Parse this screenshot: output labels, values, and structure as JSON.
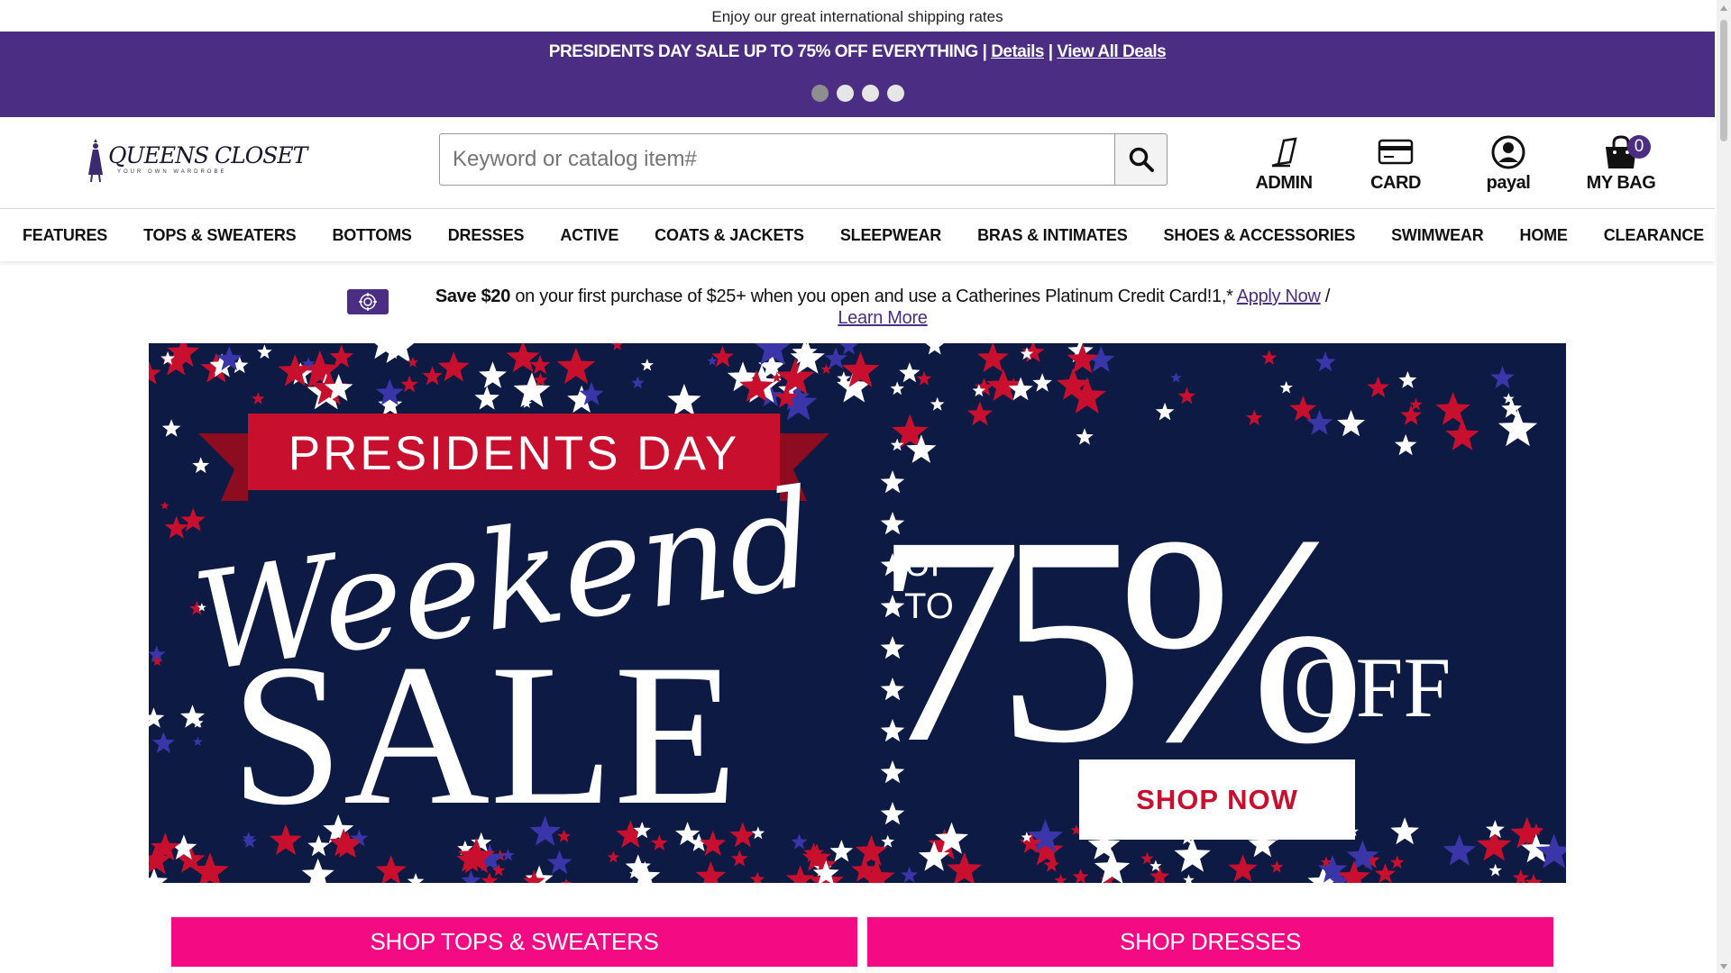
{
  "top_strip": {
    "text": "Enjoy our great international shipping rates"
  },
  "promo": {
    "headline": "PRESIDENTS DAY SALE UP TO 75% OFF EVERYTHING",
    "separator": "|",
    "details_link": "Details",
    "all_deals_link": "View All Deals",
    "slide_count": 4,
    "active_slide": 1
  },
  "header": {
    "logo_text": "QUEENS CLOSET",
    "logo_tagline": "YOUR OWN WARDROBE",
    "search": {
      "placeholder": "Keyword or catalog item#",
      "value": ""
    },
    "utilities": [
      {
        "label": "ADMIN",
        "icon": "pencil-icon"
      },
      {
        "label": "CARD",
        "icon": "credit-card-icon"
      },
      {
        "label": "payal",
        "icon": "user-icon"
      },
      {
        "label": "MY BAG",
        "icon": "shopping-bag-icon",
        "count": "0"
      }
    ]
  },
  "nav": {
    "items": [
      "FEATURES",
      "TOPS & SWEATERS",
      "BOTTOMS",
      "DRESSES",
      "ACTIVE",
      "COATS & JACKETS",
      "SLEEPWEAR",
      "BRAS & INTIMATES",
      "SHOES & ACCESSORIES",
      "SWIMWEAR",
      "HOME",
      "CLEARANCE"
    ]
  },
  "offer": {
    "bold": "Save $20",
    "text": " on your first purchase of $25+ when you open and use a Catherines Platinum Credit Card!1,* ",
    "apply_link": "Apply Now",
    "divider": " / ",
    "learn_link": "Learn More"
  },
  "hero": {
    "ribbon": "PRESIDENTS DAY",
    "script": "Weekend",
    "sale": "SALE",
    "up": "UP",
    "to": "TO",
    "percent": "75%",
    "off": "OFF",
    "cta": "SHOP NOW",
    "colors": {
      "navy": "#0d1a44",
      "red": "#c8102e",
      "white": "#ffffff",
      "blue": "#3a35a8"
    }
  },
  "categories": [
    {
      "label": "SHOP TOPS & SWEATERS"
    },
    {
      "label": "SHOP DRESSES"
    }
  ],
  "colors": {
    "brand_purple": "#4b2e83",
    "pink": "#f40b84"
  }
}
